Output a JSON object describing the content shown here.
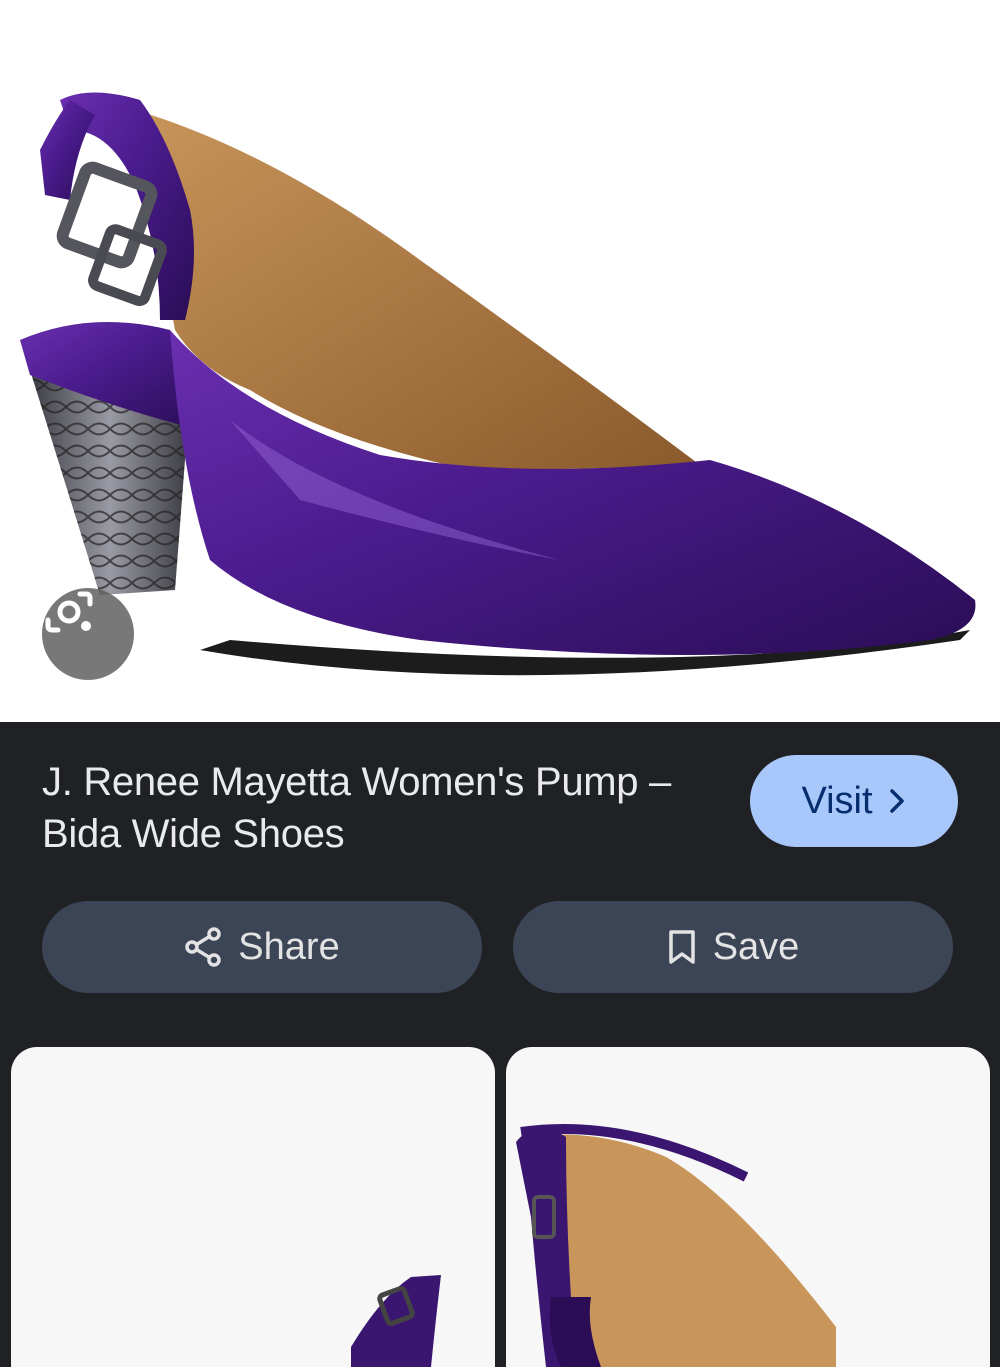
{
  "product": {
    "title": "J. Renee Mayetta Women's Pump – Bida Wide Shoes",
    "image_subject": "purple patent slingback pump"
  },
  "actions": {
    "visit_label": "Visit",
    "share_label": "Share",
    "save_label": "Save"
  },
  "icons": {
    "lens": "lens-camera-icon",
    "visit_chevron": "chevron-right-icon",
    "share": "share-icon",
    "save": "bookmark-icon"
  },
  "colors": {
    "background": "#202124",
    "visit_button": "#a8c7fa",
    "pill_button": "#3c4556",
    "shoe_purple": "#4b1c8a"
  }
}
